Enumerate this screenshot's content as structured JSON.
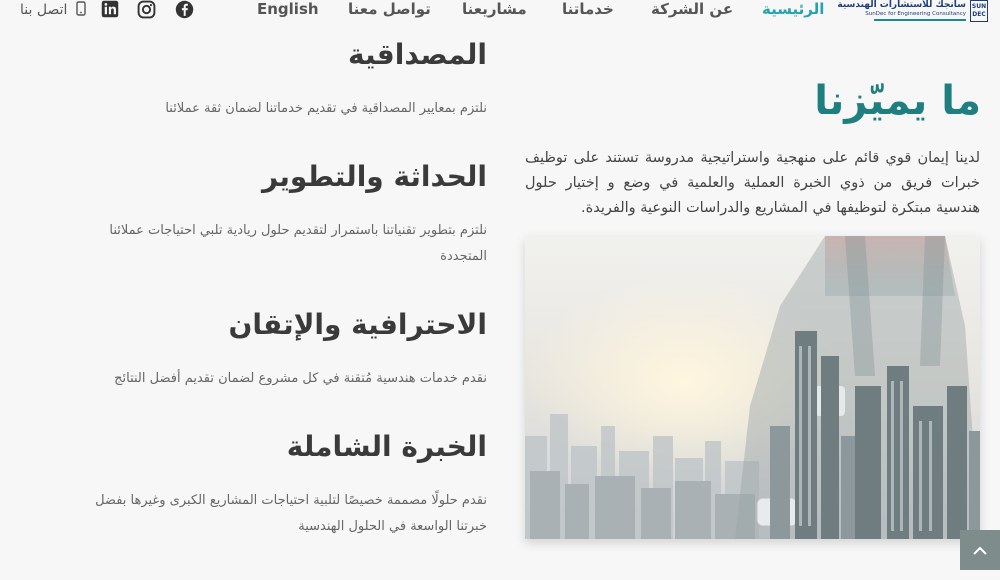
{
  "logo": {
    "arabic": "سانجك للاستشارات الهندسية",
    "english": "SunDec for Engineering Consultancy",
    "mark": "SUN DEC"
  },
  "nav": {
    "home": "الرئيسية",
    "about": "عن الشركة",
    "services": "خدماتنا",
    "projects": "مشاريعنا",
    "contact": "تواصل معنا",
    "language": "English",
    "call_us": "اتصل بنا"
  },
  "social": [
    "facebook-icon",
    "instagram-icon",
    "linkedin-icon",
    "phone-icon"
  ],
  "features": [
    {
      "title": "المصداقية",
      "desc": "نلتزم بمعايير المصداقية في تقديم خدماتنا لضمان ثقة عملائنا"
    },
    {
      "title": "الحداثة والتطوير",
      "desc": "نلتزم بتطوير تقنياتنا باستمرار لتقديم حلول ريادية تلبي احتياجات عملائنا المتجددة"
    },
    {
      "title": "الاحترافية والإتقان",
      "desc": "نقدم خدمات هندسية مُتقنة في كل مشروع لضمان تقديم أفضل النتائج"
    },
    {
      "title": "الخبرة الشاملة",
      "desc": "نقدم حلولًا مصممة خصيصًا لتلبية احتياجات المشاريع الكبرى وغيرها بفضل خبرتنا الواسعة في الحلول الهندسية"
    }
  ],
  "section": {
    "title": "ما يميّزنا",
    "paragraph": "لدينا إيمان قوي قائم على منهجية واستراتيجية مدروسة تستند على توظيف خبرات فريق من ذوي الخبرة العملية والعلمية في وضع و إختيار حلول هندسية مبتكرة لتوظيفها في المشاريع والدراسات النوعية والفريدة."
  },
  "colors": {
    "accent": "#26a3b3",
    "title": "#1f7f80",
    "scroll_button": "#7f8c8c"
  }
}
